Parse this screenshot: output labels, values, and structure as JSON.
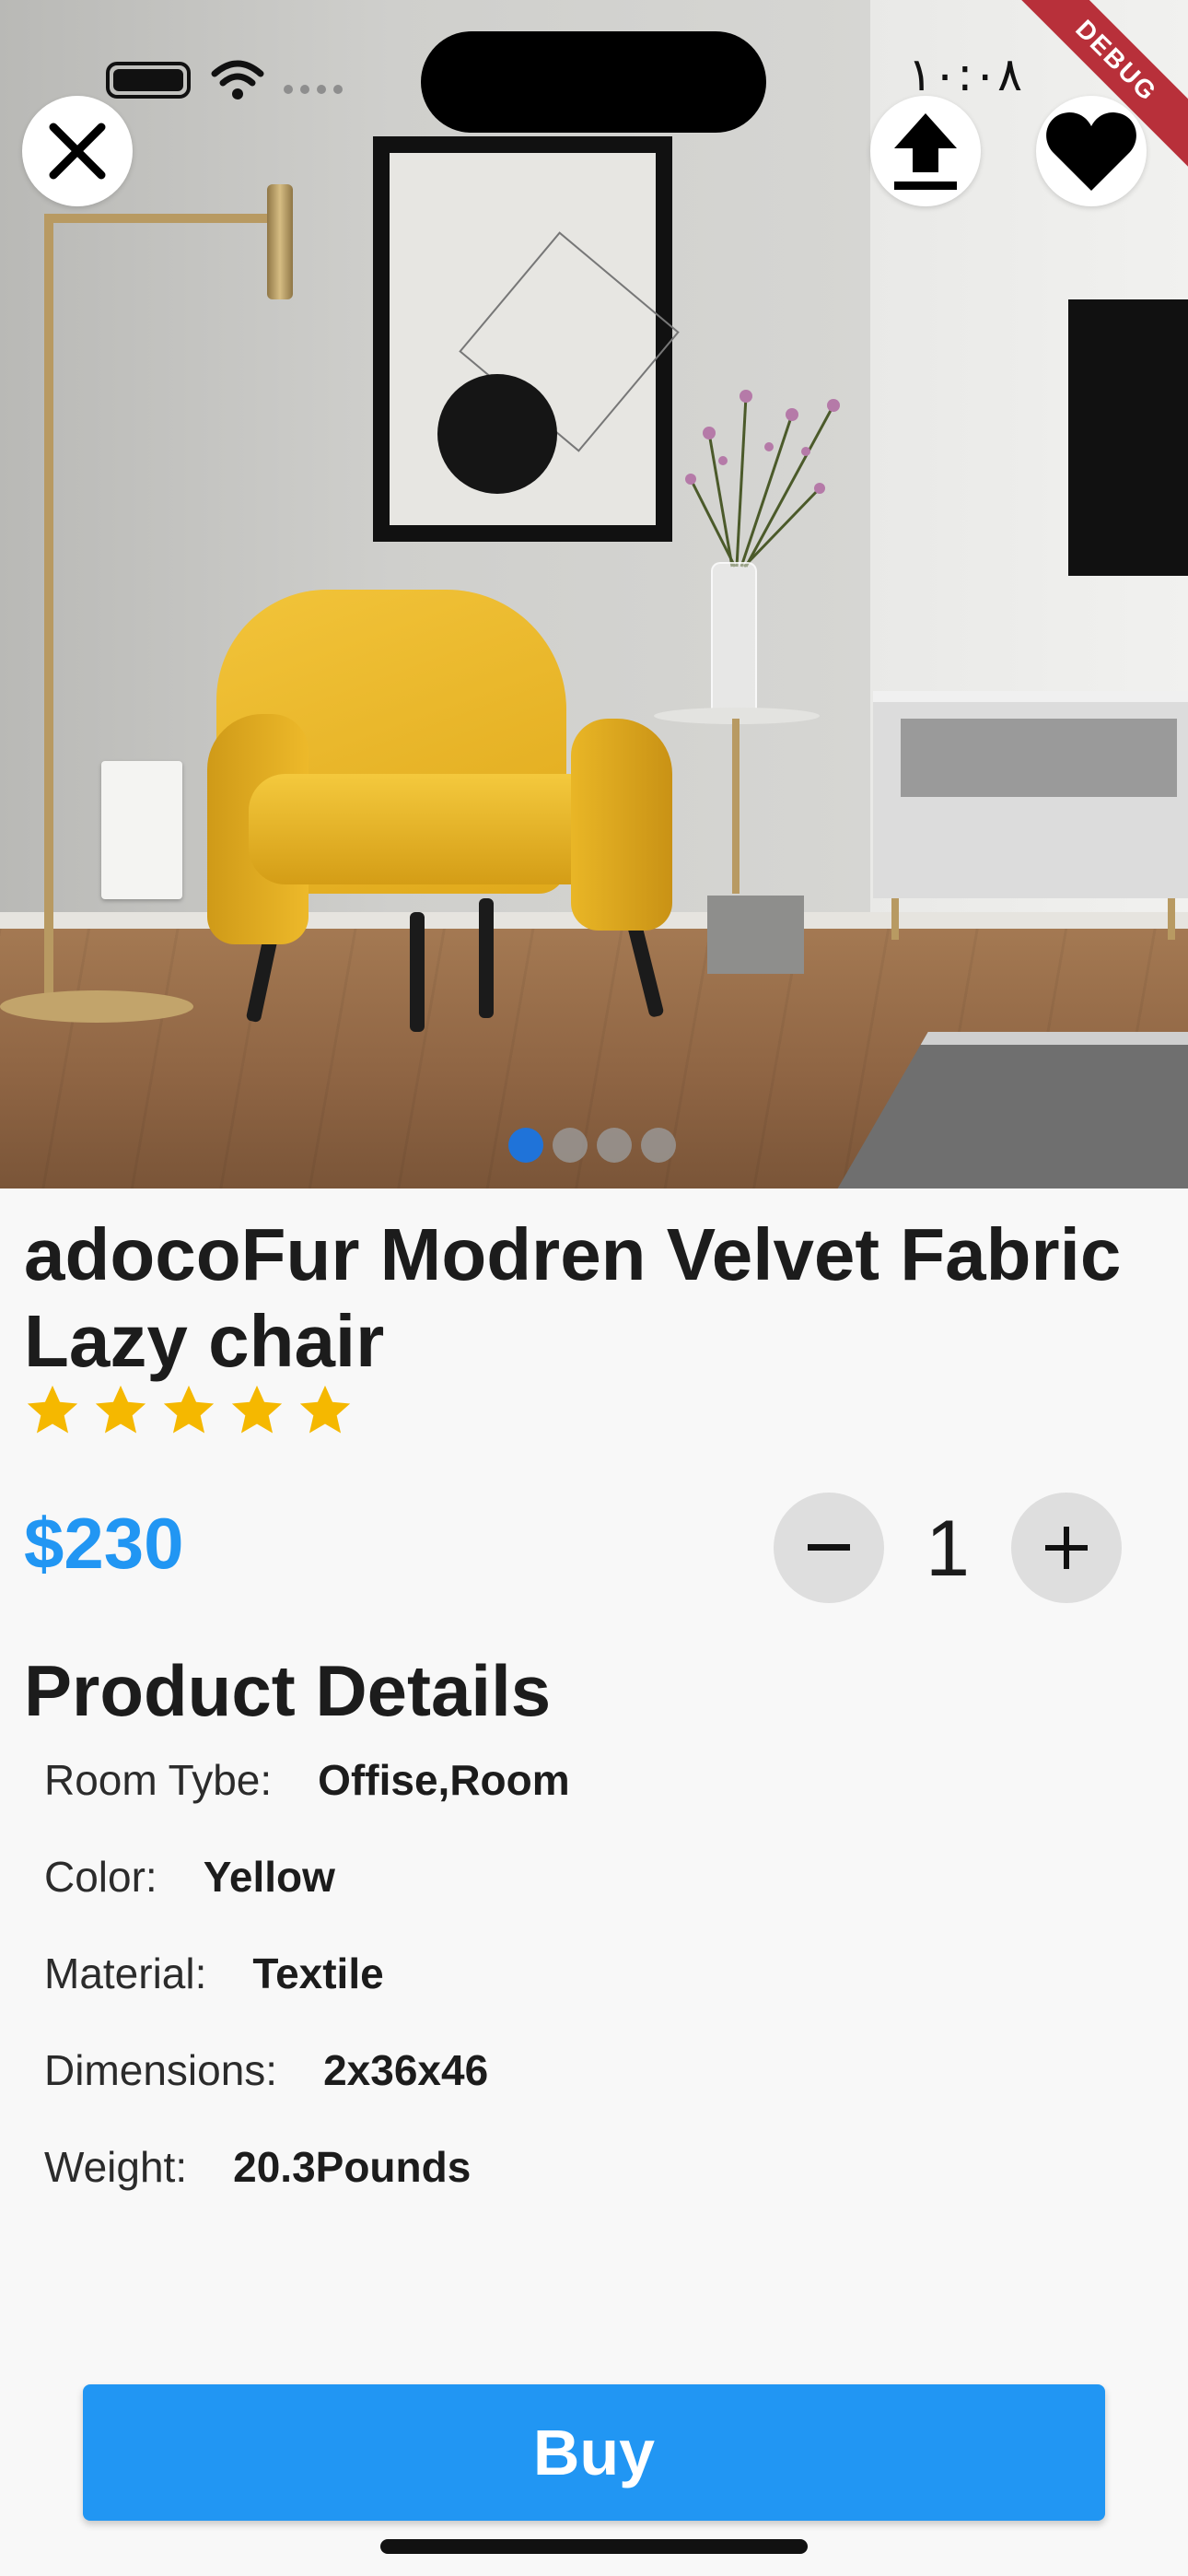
{
  "status_bar": {
    "time": "١٠:٠٨"
  },
  "debug_banner": "DEBUG",
  "carousel": {
    "total_pages": 4,
    "active_index": 0
  },
  "product": {
    "title": "adocoFur Modren Velvet Fabric Lazy chair",
    "rating": 5,
    "rating_max": 5,
    "price": "$230"
  },
  "quantity": {
    "value": "1",
    "minus_icon": "minus-icon",
    "plus_icon": "plus-icon"
  },
  "details": {
    "heading": "Product Details",
    "rows": [
      {
        "label": "Room Tybe:",
        "value": "Offise,Room"
      },
      {
        "label": "Color:",
        "value": "Yellow"
      },
      {
        "label": "Material:",
        "value": "Textile"
      },
      {
        "label": "Dimensions:",
        "value": "2x36x46"
      },
      {
        "label": "Weight:",
        "value": "20.3Pounds"
      }
    ]
  },
  "actions": {
    "close_icon": "close-icon",
    "share_icon": "share-upload-icon",
    "favorite_icon": "heart-icon",
    "buy_label": "Buy"
  },
  "colors": {
    "accent": "#2196f3",
    "star": "#f5b800",
    "page_indicator_active": "#1f73d9",
    "debug_ribbon": "#b8303a"
  }
}
